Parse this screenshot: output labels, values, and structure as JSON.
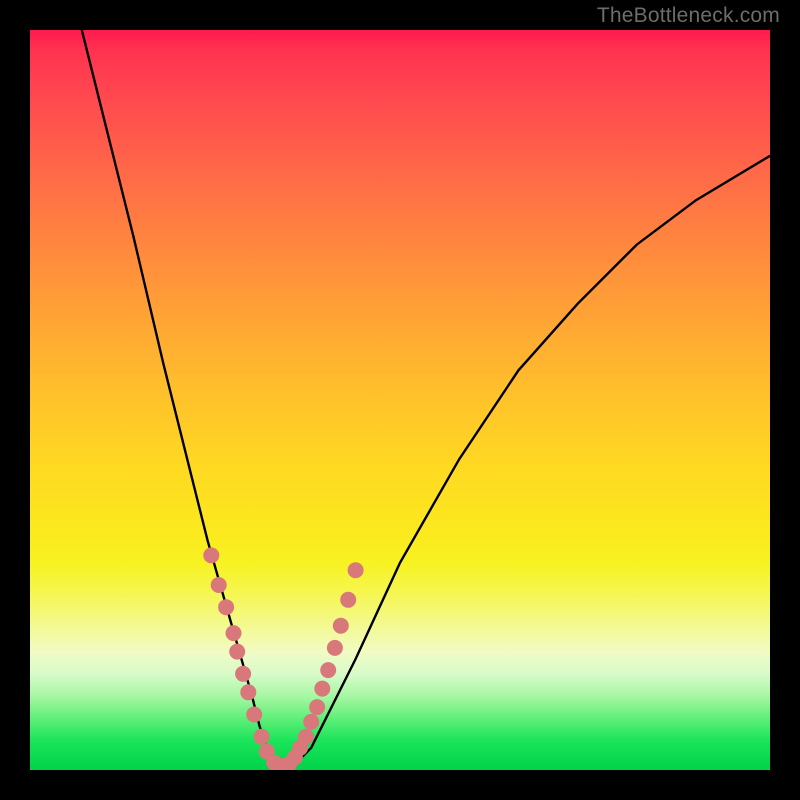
{
  "watermark": {
    "text": "TheBottleneck.com"
  },
  "chart_data": {
    "type": "line",
    "title": "",
    "xlabel": "",
    "ylabel": "",
    "xlim": [
      0,
      100
    ],
    "ylim": [
      0,
      100
    ],
    "grid": false,
    "series": [
      {
        "name": "bottleneck-curve",
        "color": "#000000",
        "x": [
          7,
          10,
          14,
          18,
          22,
          24,
          26,
          28,
          30,
          31,
          32,
          33,
          34,
          36,
          38,
          40,
          44,
          50,
          58,
          66,
          74,
          82,
          90,
          100
        ],
        "y": [
          100,
          88,
          72,
          55,
          39,
          31,
          24,
          17,
          10,
          6,
          3,
          1,
          0,
          1,
          3,
          7,
          15,
          28,
          42,
          54,
          63,
          71,
          77,
          83
        ]
      },
      {
        "name": "marker-dots",
        "color": "#d9787b",
        "x": [
          24.5,
          25.5,
          26.5,
          27.5,
          28.0,
          28.8,
          29.5,
          30.3,
          31.3,
          32.0,
          33.0,
          34.0,
          35.0,
          35.8,
          36.5,
          37.3,
          38.0,
          38.8,
          39.5,
          40.3,
          41.2,
          42.0,
          43.0,
          44.0
        ],
        "y": [
          29.0,
          25.0,
          22.0,
          18.5,
          16.0,
          13.0,
          10.5,
          7.5,
          4.5,
          2.5,
          1.0,
          0.5,
          0.8,
          1.7,
          3.0,
          4.5,
          6.5,
          8.5,
          11.0,
          13.5,
          16.5,
          19.5,
          23.0,
          27.0
        ]
      }
    ],
    "background_gradient": {
      "top": "#ff1a4f",
      "mid": "#ffdb21",
      "bottom": "#00d24a"
    }
  }
}
